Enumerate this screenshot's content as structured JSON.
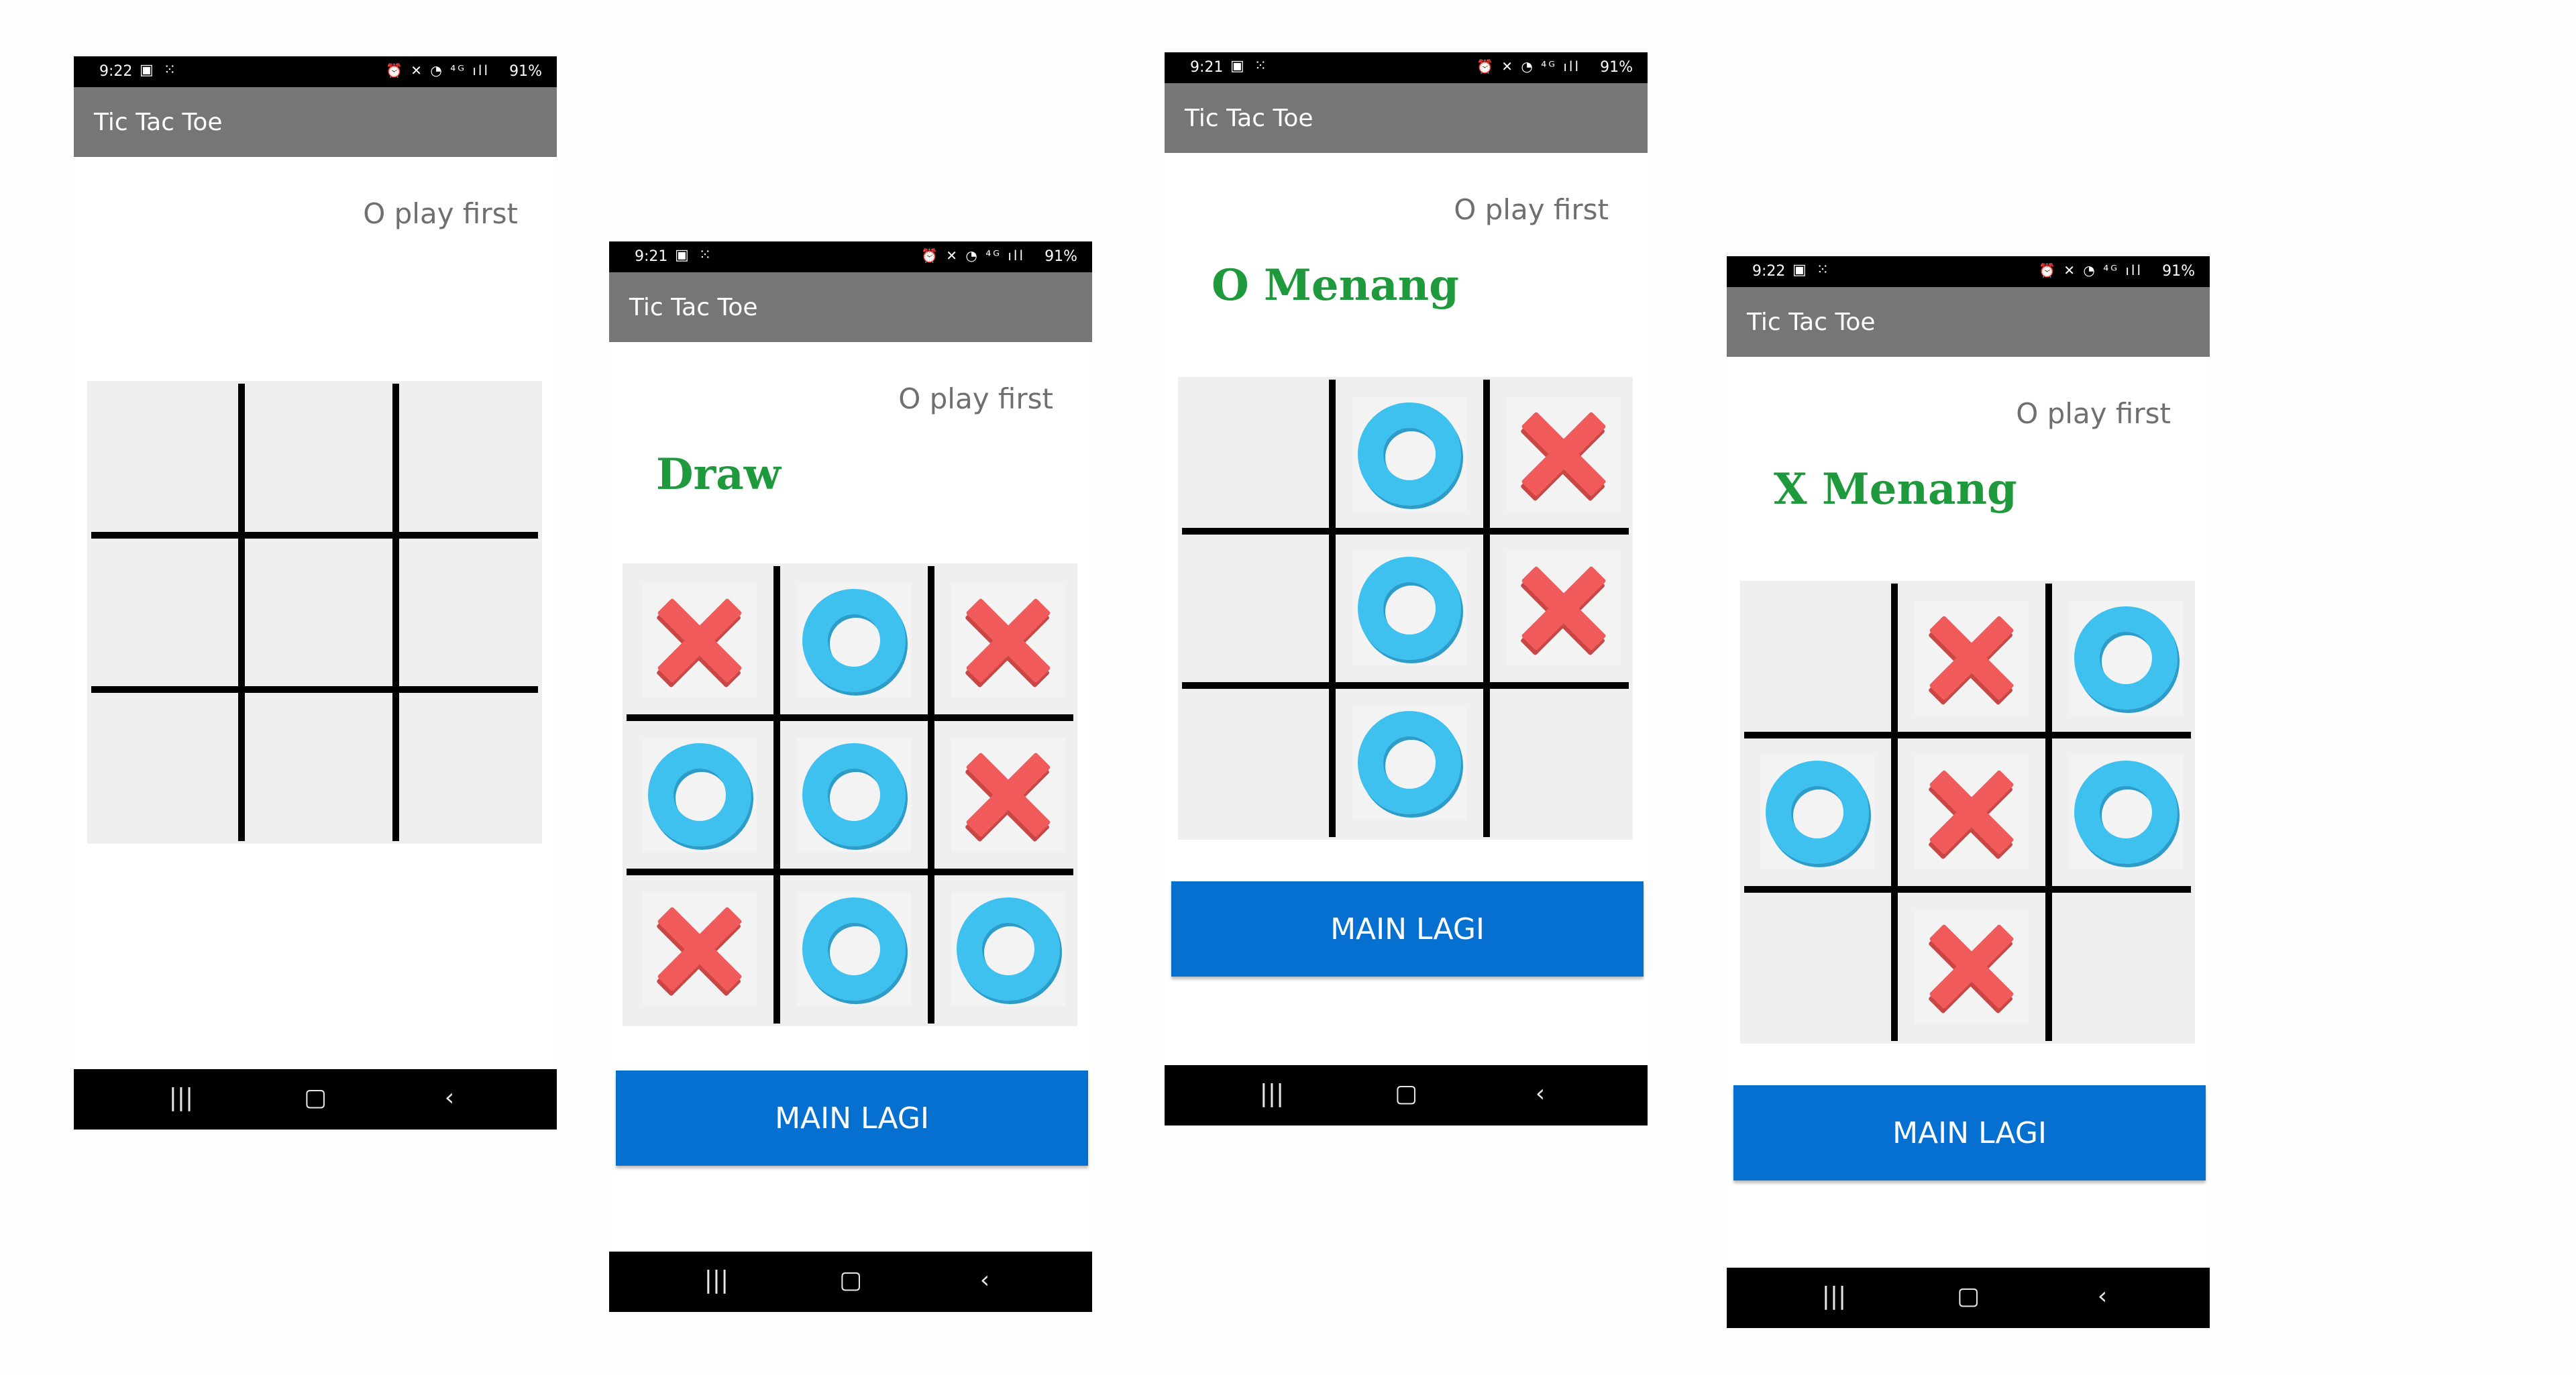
{
  "screens": [
    {
      "status_time": "9:22",
      "status_battery": "91%",
      "app_title": "Tic Tac Toe",
      "hint": "O play first",
      "result": "",
      "board": [
        "",
        "",
        "",
        "",
        "",
        "",
        "",
        "",
        ""
      ],
      "play_again": ""
    },
    {
      "status_time": "9:21",
      "status_battery": "91%",
      "app_title": "Tic Tac Toe",
      "hint": "O play first",
      "result": "Draw",
      "board": [
        "X",
        "O",
        "X",
        "O",
        "O",
        "X",
        "X",
        "O",
        "O"
      ],
      "play_again": "MAIN LAGI"
    },
    {
      "status_time": "9:21",
      "status_battery": "91%",
      "app_title": "Tic Tac Toe",
      "hint": "O play first",
      "result": "O Menang",
      "board": [
        "",
        "O",
        "X",
        "",
        "O",
        "X",
        "",
        "O",
        ""
      ],
      "play_again": "MAIN LAGI"
    },
    {
      "status_time": "9:22",
      "status_battery": "91%",
      "app_title": "Tic Tac Toe",
      "hint": "O play first",
      "result": "X Menang",
      "board": [
        "",
        "X",
        "O",
        "O",
        "X",
        "O",
        "",
        "X",
        ""
      ],
      "play_again": "MAIN LAGI"
    }
  ],
  "icons": {
    "status_left": "gallery-icon, grid-icon",
    "status_right": "alarm-icon, mute-icon, wifi-icon, signal-icon, battery-icon",
    "nav": [
      "recents-icon",
      "home-icon",
      "back-icon"
    ],
    "x_mark": "x-mark-icon",
    "o_mark": "o-mark-icon"
  },
  "colors": {
    "appbar": "#767676",
    "result_text": "#1e9a3c",
    "button": "#0570cf",
    "x_mark": "#f05a5a",
    "o_mark": "#3fc1ef",
    "board_bg": "#efefef"
  }
}
